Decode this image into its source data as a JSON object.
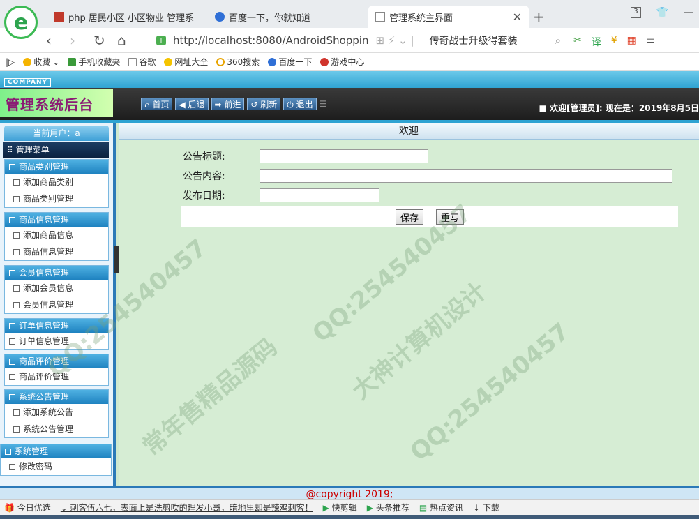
{
  "browser": {
    "tabs": [
      {
        "label": "php 居民小区 小区物业 管理系"
      },
      {
        "label": "百度一下，你就知道"
      },
      {
        "label": "管理系统主界面"
      }
    ],
    "tab_count": "3",
    "url": "http://localhost:8080/AndroidShoppin",
    "search_text": "传奇战士升级得套装",
    "bookmarks": [
      "收藏",
      "手机收藏夹",
      "谷歌",
      "网址大全",
      "360搜索",
      "百度一下",
      "游戏中心"
    ]
  },
  "header": {
    "company": "COMPANY",
    "title": "管理系统后台",
    "nav": [
      "首页",
      "后退",
      "前进",
      "刷新",
      "退出"
    ],
    "welcome": "■ 欢迎[管理员]:  现在是：2019年8月5日"
  },
  "sidebar": {
    "current_user": "当前用户：a",
    "main_menu": "管理菜单",
    "groups": [
      {
        "title": "商品类别管理",
        "items": [
          "添加商品类别",
          "商品类别管理"
        ]
      },
      {
        "title": "商品信息管理",
        "items": [
          "添加商品信息",
          "商品信息管理"
        ]
      },
      {
        "title": "会员信息管理",
        "items": [
          "添加会员信息",
          "会员信息管理"
        ]
      },
      {
        "title": "订单信息管理",
        "items": [
          "订单信息管理"
        ]
      },
      {
        "title": "商品评价管理",
        "items": [
          "商品评价管理"
        ]
      },
      {
        "title": "系统公告管理",
        "items": [
          "添加系统公告",
          "系统公告管理"
        ]
      },
      {
        "title": "系统管理",
        "items": [
          "修改密码"
        ]
      }
    ]
  },
  "content": {
    "title": "欢迎",
    "form": {
      "title_label": "公告标题:",
      "title_value": "",
      "content_label": "公告内容:",
      "content_value": "",
      "date_label": "发布日期:",
      "date_value": "",
      "save": "保存",
      "reset": "重写"
    }
  },
  "footer": {
    "copyright": "@copyright 2019;"
  },
  "statusbar": {
    "items": [
      "今日优选",
      "刺客伍六七，表面上是洗剪吹的理发小哥，暗地里却是辣鸡刺客！",
      "快剪辑",
      "头条推荐",
      "热点资讯",
      "下载"
    ]
  },
  "watermarks": [
    "QQ:254540457",
    "大神计算机设计",
    "常年售精品源码"
  ]
}
